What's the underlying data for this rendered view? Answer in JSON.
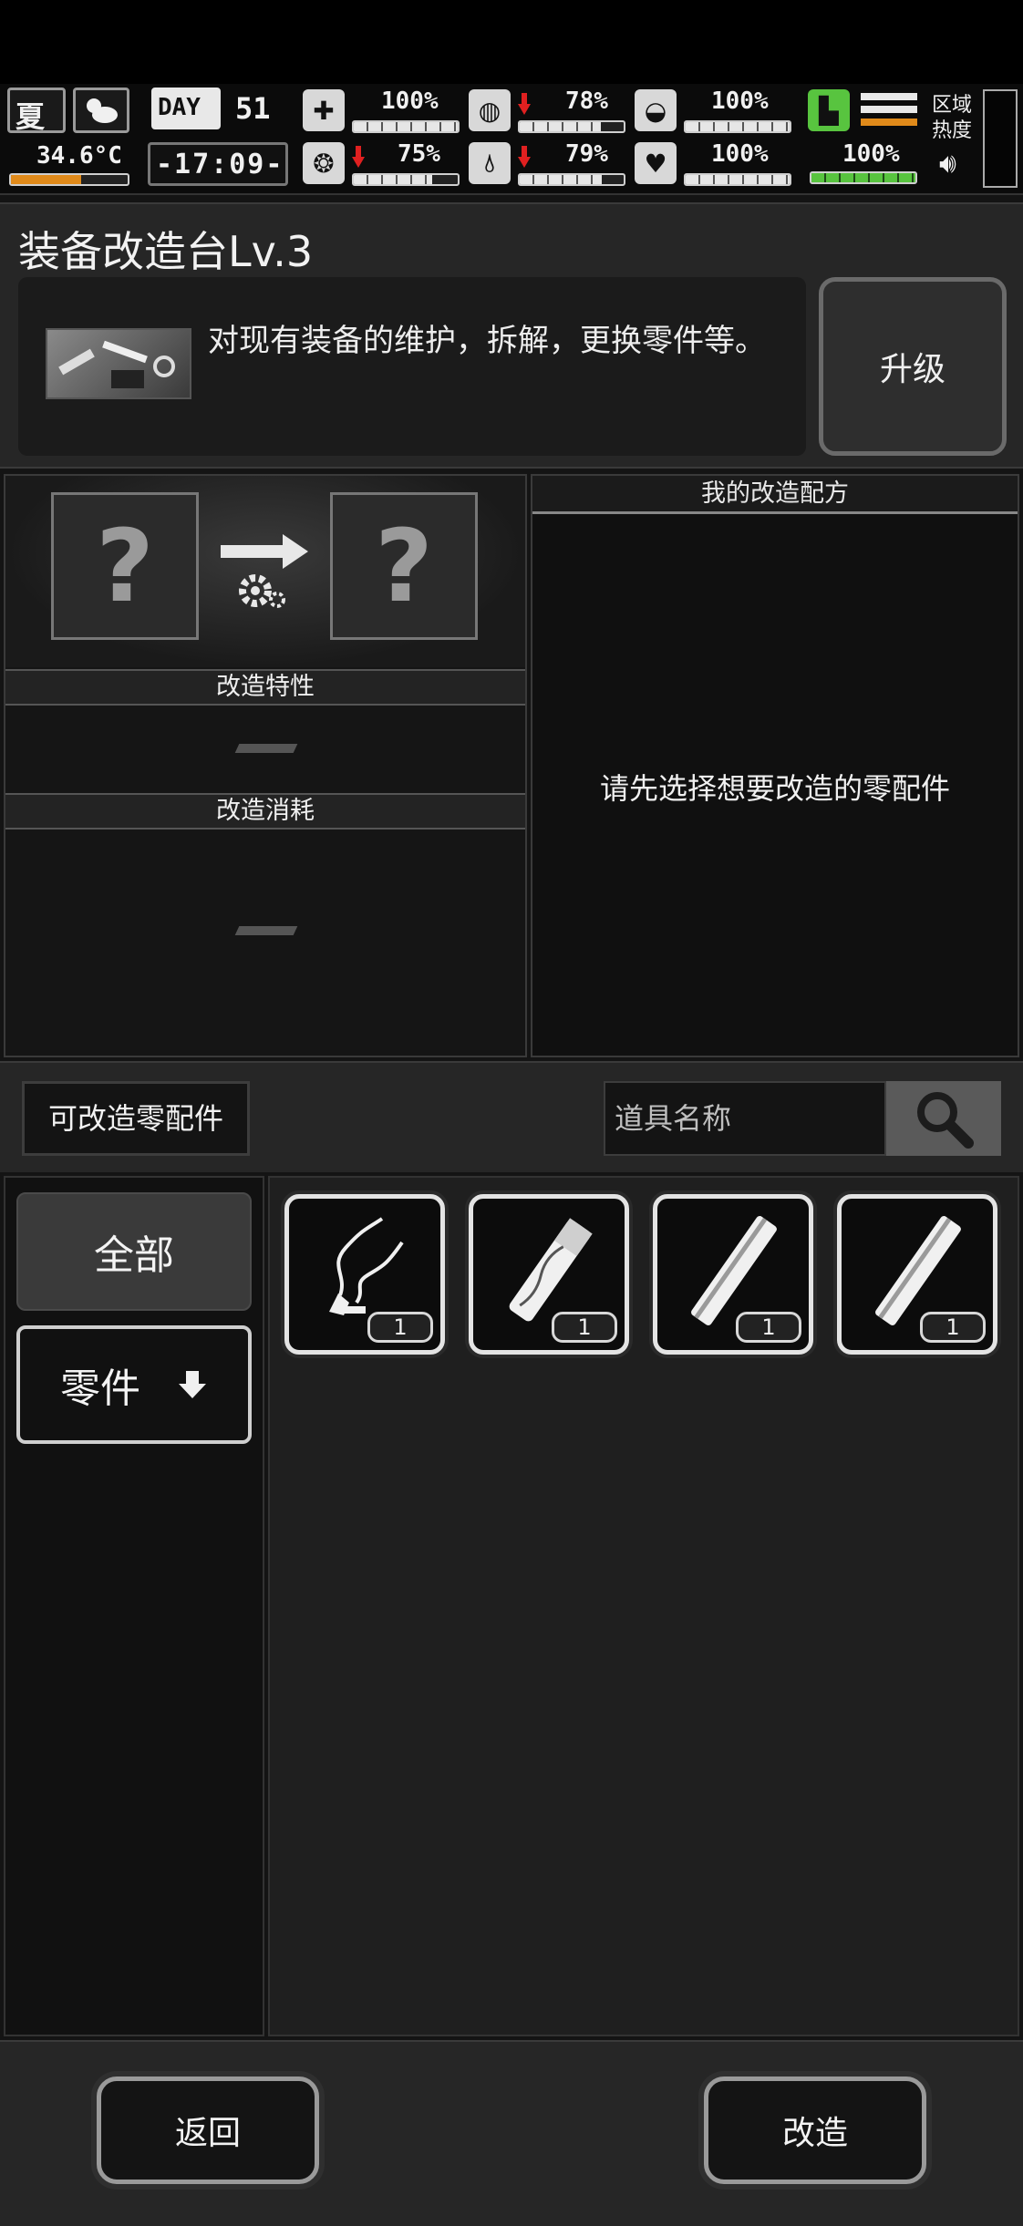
{
  "hud": {
    "season": "夏",
    "temperature": "34.6°C",
    "day_label": "DAY",
    "day_number": "51",
    "time": "-17:09-",
    "stats": [
      {
        "name": "health",
        "value": "100%",
        "level": 1.0,
        "falling": false
      },
      {
        "name": "hunger",
        "value": "78%",
        "level": 0.78,
        "falling": true
      },
      {
        "name": "defense",
        "value": "100%",
        "level": 1.0,
        "falling": false
      },
      {
        "name": "stamina",
        "value": "100%",
        "level": 1.0,
        "falling": false
      },
      {
        "name": "sanity",
        "value": "75%",
        "level": 0.75,
        "falling": true
      },
      {
        "name": "thirst",
        "value": "79%",
        "level": 0.79,
        "falling": true
      },
      {
        "name": "mood",
        "value": "100%",
        "level": 1.0,
        "falling": false
      }
    ],
    "area_heat_label": "区域热度",
    "temperature_level": 0.6
  },
  "panel": {
    "title": "装备改造台Lv.3",
    "description": "对现有装备的维护，拆解，更换零件等。",
    "upgrade_label": "升级"
  },
  "bench": {
    "slot_left": "?",
    "slot_right": "?",
    "traits_header": "改造特性",
    "cost_header": "改造消耗",
    "recipes_header": "我的改造配方",
    "recipes_empty": "请先选择想要改造的零配件"
  },
  "inventory": {
    "filter_chip": "可改造零配件",
    "search_placeholder": "道具名称",
    "categories": [
      {
        "label": "全部"
      },
      {
        "label": "零件"
      }
    ],
    "items": [
      {
        "icon": "wire-parts-icon",
        "count": "1"
      },
      {
        "icon": "wood-stick-icon",
        "count": "1"
      },
      {
        "icon": "metal-pipe-icon",
        "count": "1"
      },
      {
        "icon": "metal-pipe-icon",
        "count": "1"
      }
    ]
  },
  "footer": {
    "back_label": "返回",
    "modify_label": "改造"
  },
  "colors": {
    "accent_green": "#58c43f",
    "accent_red": "#e02020",
    "accent_orange": "#e08a1a"
  }
}
